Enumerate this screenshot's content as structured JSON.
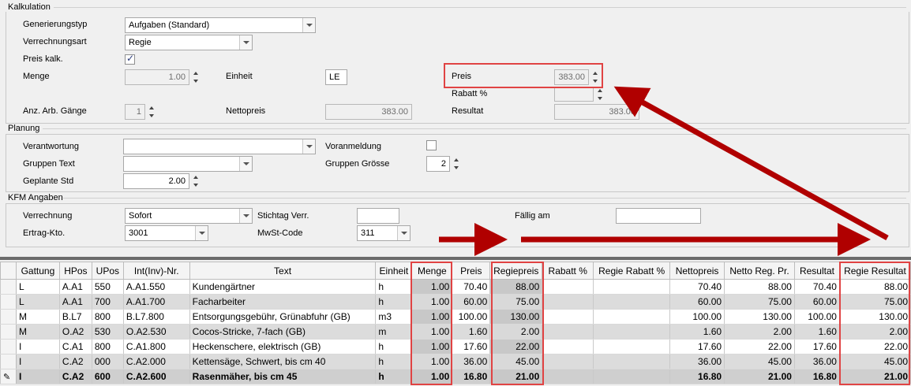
{
  "sections": {
    "kalkulation": "Kalkulation",
    "planung": "Planung",
    "kfm": "KFM Angaben"
  },
  "kalkulation": {
    "generierungstyp_label": "Generierungstyp",
    "generierungstyp_value": "Aufgaben (Standard)",
    "verrechnungsart_label": "Verrechnungsart",
    "verrechnungsart_value": "Regie",
    "preis_kalk_label": "Preis kalk.",
    "preis_kalk_checked": true,
    "menge_label": "Menge",
    "menge_value": "1.00",
    "einheit_label": "Einheit",
    "einheit_value": "LE",
    "preis_label": "Preis",
    "preis_value": "383.00",
    "rabatt_label": "Rabatt %",
    "rabatt_value": "",
    "anz_label": "Anz. Arb. Gänge",
    "anz_value": "1",
    "nettopreis_label": "Nettopreis",
    "nettopreis_value": "383.00",
    "resultat_label": "Resultat",
    "resultat_value": "383.00"
  },
  "planung": {
    "verantwortung_label": "Verantwortung",
    "verantwortung_value": "",
    "voranmeldung_label": "Voranmeldung",
    "voranmeldung_checked": false,
    "gruppen_text_label": "Gruppen Text",
    "gruppen_text_value": "",
    "gruppen_groesse_label": "Gruppen Grösse",
    "gruppen_groesse_value": "2",
    "geplante_std_label": "Geplante Std",
    "geplante_std_value": "2.00"
  },
  "kfm": {
    "verrechnung_label": "Verrechnung",
    "verrechnung_value": "Sofort",
    "stichtag_label": "Stichtag Verr.",
    "stichtag_value": "",
    "faellig_label": "Fällig am",
    "faellig_value": "",
    "ertrag_label": "Ertrag-Kto.",
    "ertrag_value": "3001",
    "mwst_label": "MwSt-Code",
    "mwst_value": "311"
  },
  "grid": {
    "columns": [
      "Gattung",
      "HPos",
      "UPos",
      "Int(Inv)-Nr.",
      "Text",
      "Einheit",
      "Menge",
      "Preis",
      "Regiepreis",
      "Rabatt %",
      "Regie Rabatt %",
      "Nettopreis",
      "Netto Reg. Pr.",
      "Resultat",
      "Regie Resultat"
    ],
    "rows": [
      [
        "L",
        "A.A1",
        "550",
        "A.A1.550",
        "Kundengärtner",
        "h",
        "1.00",
        "70.40",
        "88.00",
        "",
        "",
        "70.40",
        "88.00",
        "70.40",
        "88.00"
      ],
      [
        "L",
        "A.A1",
        "700",
        "A.A1.700",
        "Facharbeiter",
        "h",
        "1.00",
        "60.00",
        "75.00",
        "",
        "",
        "60.00",
        "75.00",
        "60.00",
        "75.00"
      ],
      [
        "M",
        "B.L7",
        "800",
        "B.L7.800",
        "Entsorgungsgebühr, Grünabfuhr (GB)",
        "m3",
        "1.00",
        "100.00",
        "130.00",
        "",
        "",
        "100.00",
        "130.00",
        "100.00",
        "130.00"
      ],
      [
        "M",
        "O.A2",
        "530",
        "O.A2.530",
        "Cocos-Stricke, 7-fach (GB)",
        "m",
        "1.00",
        "1.60",
        "2.00",
        "",
        "",
        "1.60",
        "2.00",
        "1.60",
        "2.00"
      ],
      [
        "I",
        "C.A1",
        "800",
        "C.A1.800",
        "Heckenschere, elektrisch (GB)",
        "h",
        "1.00",
        "17.60",
        "22.00",
        "",
        "",
        "17.60",
        "22.00",
        "17.60",
        "22.00"
      ],
      [
        "I",
        "C.A2",
        "000",
        "C.A2.000",
        "Kettensäge, Schwert, bis cm 40",
        "h",
        "1.00",
        "36.00",
        "45.00",
        "",
        "",
        "36.00",
        "45.00",
        "36.00",
        "45.00"
      ],
      [
        "I",
        "C.A2",
        "600",
        "C.A2.600",
        "Rasenmäher, bis cm 45",
        "h",
        "1.00",
        "16.80",
        "21.00",
        "",
        "",
        "16.80",
        "21.00",
        "16.80",
        "21.00"
      ]
    ]
  },
  "colors": {
    "highlight_box": "#e04343",
    "arrow": "#b00000"
  }
}
